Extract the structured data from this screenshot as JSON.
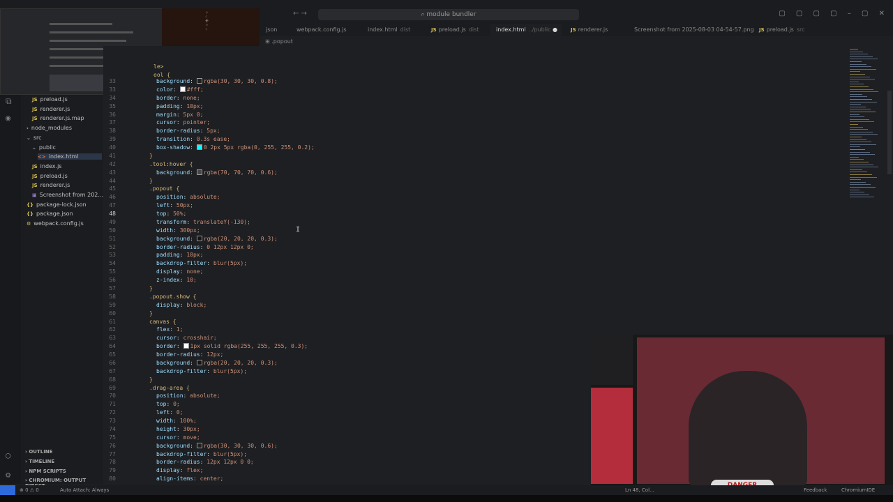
{
  "titlebar": {
    "search_text": "module bundler",
    "nav_arrows": "← →",
    "window_controls": "▢ ▢ ▢ ▢ – ▢ ✕"
  },
  "tabs": [
    {
      "badge": "",
      "label": "json",
      "hint": ""
    },
    {
      "badge": "",
      "label": "webpack.config.js",
      "hint": ""
    },
    {
      "badge": "",
      "label": "index.html",
      "hint": "dist"
    },
    {
      "badge": "JS",
      "label": "preload.js",
      "hint": "dist"
    },
    {
      "badge": "",
      "label": "index.html",
      "hint": "../public",
      "active": true
    },
    {
      "badge": "JS",
      "label": "renderer.js",
      "hint": ""
    },
    {
      "badge": "",
      "label": "Screenshot from 2025-08-03 04-54-57.png",
      "hint": ""
    },
    {
      "badge": "JS",
      "label": "preload.js",
      "hint": "src"
    }
  ],
  "breadcrumb": ".popout",
  "explorer": {
    "items": [
      {
        "icon": "JS",
        "type": "js",
        "label": "preload.js",
        "indent": 1
      },
      {
        "icon": "JS",
        "type": "js",
        "label": "renderer.js",
        "indent": 1
      },
      {
        "icon": "JS",
        "type": "js",
        "label": "renderer.js.map",
        "indent": 1
      },
      {
        "icon": "›",
        "type": "folder",
        "label": "node_modules",
        "indent": 0
      },
      {
        "icon": "⌄",
        "type": "folder",
        "label": "src",
        "indent": 0
      },
      {
        "icon": "⌄",
        "type": "folder",
        "label": "public",
        "indent": 1
      },
      {
        "icon": "<>",
        "type": "html",
        "label": "index.html",
        "indent": 2,
        "selected": true
      },
      {
        "icon": "JS",
        "type": "js",
        "label": "index.js",
        "indent": 1
      },
      {
        "icon": "JS",
        "type": "js",
        "label": "preload.js",
        "indent": 1
      },
      {
        "icon": "JS",
        "type": "js",
        "label": "renderer.js",
        "indent": 1
      },
      {
        "icon": "▣",
        "type": "img",
        "label": "Screenshot from 202...",
        "indent": 1
      },
      {
        "icon": "{}",
        "type": "json",
        "label": "package-lock.json",
        "indent": 0
      },
      {
        "icon": "{}",
        "type": "json",
        "label": "package.json",
        "indent": 0
      },
      {
        "icon": "⚙",
        "type": "json",
        "label": "webpack.config.js",
        "indent": 0
      }
    ],
    "panels": [
      "OUTLINE",
      "TIMELINE",
      "NPM SCRIPTS",
      "CHROMIUM: OUTPUT DIRECT..."
    ]
  },
  "editor": {
    "current_line": 48,
    "header_lines": [
      {
        "text": "le>"
      },
      {
        "text": "ool {"
      }
    ],
    "lines": [
      {
        "n": "33",
        "indent": 2,
        "prop": "background",
        "val": "rgba(30, 30, 30, 0.8);",
        "swatch": "#1e1e1e"
      },
      {
        "n": "33",
        "indent": 2,
        "prop": "color",
        "val": "#fff;",
        "swatch": "#ffffff"
      },
      {
        "n": "34",
        "indent": 2,
        "prop": "border",
        "val": "none;"
      },
      {
        "n": "35",
        "indent": 2,
        "prop": "padding",
        "val": "10px;"
      },
      {
        "n": "36",
        "indent": 2,
        "prop": "margin",
        "val": "5px 0;"
      },
      {
        "n": "37",
        "indent": 2,
        "prop": "cursor",
        "val": "pointer;"
      },
      {
        "n": "38",
        "indent": 2,
        "prop": "border-radius",
        "val": "5px;"
      },
      {
        "n": "39",
        "indent": 2,
        "prop": "transition",
        "val": "0.3s ease;"
      },
      {
        "n": "40",
        "indent": 2,
        "prop": "box-shadow",
        "val": "0 2px 5px rgba(0, 255, 255, 0.2);",
        "swatch": "#00ffff"
      },
      {
        "n": "41",
        "indent": 1,
        "sel": "}"
      },
      {
        "n": "42",
        "indent": 1,
        "sel": ".tool:hover {"
      },
      {
        "n": "43",
        "indent": 2,
        "prop": "background",
        "val": "rgba(70, 70, 70, 0.6);",
        "swatch": "#464646"
      },
      {
        "n": "44",
        "indent": 1,
        "sel": "}"
      },
      {
        "n": "45",
        "indent": 1,
        "sel": ".popout {"
      },
      {
        "n": "46",
        "indent": 2,
        "prop": "position",
        "val": "absolute;"
      },
      {
        "n": "47",
        "indent": 2,
        "prop": "left",
        "val": "50px;"
      },
      {
        "n": "48",
        "indent": 2,
        "prop": "top",
        "val": "50%;"
      },
      {
        "n": "49",
        "indent": 2,
        "prop": "transform",
        "val": "translateY(-130);"
      },
      {
        "n": "50",
        "indent": 2,
        "prop": "width",
        "val": "300px;"
      },
      {
        "n": "51",
        "indent": 2,
        "prop": "background",
        "val": "rgba(20, 20, 20, 0.3);",
        "swatch": "#141414"
      },
      {
        "n": "52",
        "indent": 2,
        "prop": "border-radius",
        "val": "0 12px 12px 0;"
      },
      {
        "n": "53",
        "indent": 2,
        "prop": "padding",
        "val": "10px;"
      },
      {
        "n": "54",
        "indent": 2,
        "prop": "backdrop-filter",
        "val": "blur(5px);"
      },
      {
        "n": "55",
        "indent": 2,
        "prop": "display",
        "val": "none;"
      },
      {
        "n": "56",
        "indent": 2,
        "prop": "z-index",
        "val": "10;"
      },
      {
        "n": "57",
        "indent": 1,
        "sel": "}"
      },
      {
        "n": "58",
        "indent": 1,
        "sel": ".popout.show {"
      },
      {
        "n": "59",
        "indent": 2,
        "prop": "display",
        "val": "block;"
      },
      {
        "n": "60",
        "indent": 1,
        "sel": "}"
      },
      {
        "n": "61",
        "indent": 1,
        "sel": "canvas {"
      },
      {
        "n": "62",
        "indent": 2,
        "prop": "flex",
        "val": "1;"
      },
      {
        "n": "63",
        "indent": 2,
        "prop": "cursor",
        "val": "crosshair;"
      },
      {
        "n": "64",
        "indent": 2,
        "prop": "border",
        "val": "1px solid rgba(255, 255, 255, 0.3);",
        "swatch": "#ffffff"
      },
      {
        "n": "65",
        "indent": 2,
        "prop": "border-radius",
        "val": "12px;"
      },
      {
        "n": "66",
        "indent": 2,
        "prop": "background",
        "val": "rgba(20, 20, 20, 0.3);",
        "swatch": "#141414"
      },
      {
        "n": "67",
        "indent": 2,
        "prop": "backdrop-filter",
        "val": "blur(5px);"
      },
      {
        "n": "68",
        "indent": 1,
        "sel": "}"
      },
      {
        "n": "69",
        "indent": 1,
        "sel": ".drag-area {"
      },
      {
        "n": "70",
        "indent": 2,
        "prop": "position",
        "val": "absolute;"
      },
      {
        "n": "71",
        "indent": 2,
        "prop": "top",
        "val": "0;"
      },
      {
        "n": "72",
        "indent": 2,
        "prop": "left",
        "val": "0;"
      },
      {
        "n": "73",
        "indent": 2,
        "prop": "width",
        "val": "100%;"
      },
      {
        "n": "74",
        "indent": 2,
        "prop": "height",
        "val": "30px;"
      },
      {
        "n": "75",
        "indent": 2,
        "prop": "cursor",
        "val": "move;"
      },
      {
        "n": "76",
        "indent": 2,
        "prop": "background",
        "val": "rgba(30, 30, 30, 0.6);",
        "swatch": "#1e1e1e"
      },
      {
        "n": "77",
        "indent": 2,
        "prop": "backdrop-filter",
        "val": "blur(5px);"
      },
      {
        "n": "78",
        "indent": 2,
        "prop": "border-radius",
        "val": "12px 12px 0 0;"
      },
      {
        "n": "79",
        "indent": 2,
        "prop": "display",
        "val": "flex;"
      },
      {
        "n": "80",
        "indent": 2,
        "prop": "align-items",
        "val": "center;"
      }
    ]
  },
  "webcam": {
    "shirt_text": "DANGER"
  },
  "statusbar": {
    "errors": "⊗ 0 ⚠ 0",
    "auto_attach": "Auto Attach: Always",
    "position": "Ln 48, Col...",
    "feedback": "Feedback",
    "chromium": "ChromiumIDE"
  },
  "colors": {
    "accent": "#2d6bdc",
    "js_icon": "#d8c04a",
    "html_icon": "#e07a4a"
  }
}
